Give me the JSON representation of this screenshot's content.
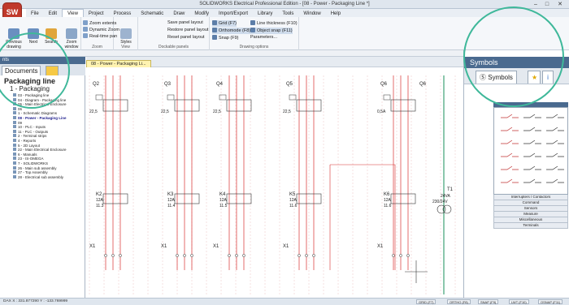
{
  "app": {
    "title": "SOLIDWORKS Electrical Professional Edition - [08 - Power - Packaging Line *]",
    "logo": "SW"
  },
  "menus": [
    "File",
    "Edit",
    "View",
    "Project",
    "Process",
    "Schematic",
    "Draw",
    "Modify",
    "Import/Export",
    "Library",
    "Tools",
    "Window",
    "Help"
  ],
  "active_menu": "View",
  "ribbon": {
    "view_group": {
      "label": "View",
      "previous": "Previous drawing",
      "next": "Next",
      "search": "Search",
      "zoom_window": "Zoom window",
      "zoom_extents": "Zoom extents",
      "dynamic_zoom": "Dynamic Zoom",
      "realtime_pan": "Real-time pan",
      "zoom_label": "Zoom"
    },
    "styles_group": {
      "label": "View",
      "styles": "Styles"
    },
    "panels_group": {
      "label": "Dockable panels",
      "save": "Save panel layout",
      "restore": "Restore panel layout",
      "reset": "Reset panel layout"
    },
    "drawing_options": {
      "label": "Drawing options",
      "grid": "Grid (F7)",
      "ortho": "Orthomode (F8)",
      "snap": "Snap (F9)",
      "line_thickness": "Line thickness (F10)",
      "object_snap": "Object snap (F11)",
      "parameters": "Parameters..."
    }
  },
  "left_panel": {
    "header": "nts",
    "tab": "Documents",
    "project": "Packaging line",
    "project_sub": "1 - Packaging",
    "tree": [
      {
        "label": "03 - Packaging line",
        "bold": false
      },
      {
        "label": "04 - Diagram - Packaging line",
        "bold": false
      },
      {
        "label": "05 - Main Electrical Enclosure",
        "bold": false
      },
      {
        "label": "06",
        "bold": false
      },
      {
        "label": "1 - Schematic Diagrams",
        "bold": false
      },
      {
        "label": "08 - Power - Packaging Line",
        "bold": true
      },
      {
        "label": "09",
        "bold": false
      },
      {
        "label": "10 - PLC - Inputs",
        "bold": false
      },
      {
        "label": "11 - PLC - Outputs",
        "bold": false
      },
      {
        "label": "2 - Terminal strips",
        "bold": false
      },
      {
        "label": "4 - Reports",
        "bold": false
      },
      {
        "label": "5 - 2D Layout",
        "bold": false
      },
      {
        "label": "22 - Main Electrical Enclosure",
        "bold": false
      },
      {
        "label": "6 - Manuals",
        "bold": false
      },
      {
        "label": "23 - IS-OMEGA",
        "bold": false
      },
      {
        "label": "7 - SOLIDWORKS",
        "bold": false
      },
      {
        "label": "26 - Main sub assembly",
        "bold": false
      },
      {
        "label": "27 - Top Assembly",
        "bold": false
      },
      {
        "label": "28 - Electrical sub assembly",
        "bold": false
      }
    ]
  },
  "canvas": {
    "tab": "08 - Power - Packaging Li...",
    "breakers": [
      "Q2",
      "Q3",
      "Q4",
      "Q5",
      "Q6"
    ],
    "breaker_ratings": [
      "22,5",
      "22,5",
      "22,5",
      "22,5",
      "0,5A"
    ],
    "contactors": [
      "K2",
      "K3",
      "K4",
      "K5",
      "K6"
    ],
    "contactor_ratings": [
      "12A",
      "12A",
      "12A",
      "12A",
      "12A"
    ],
    "contactor_refs": [
      "11.3",
      "11.4",
      "11.5",
      "11.6",
      "11.6"
    ],
    "transformer": {
      "name": "T1",
      "rating": "24VA",
      "voltage": "230/24V"
    },
    "terminals": [
      "X1",
      "X1",
      "X1",
      "X1",
      "X1"
    ]
  },
  "right_panel": {
    "header": "Symbols",
    "tab": "Symbols",
    "categories": [
      "Interrupters / Contactors",
      "Command",
      "Sensors",
      "Measure",
      "Miscellaneous",
      "Terminals"
    ]
  },
  "status": {
    "coords": "DAX X : 331.877290 Y : -133.769999",
    "buttons": [
      "GRID (F7)",
      "ORTHO (F8)",
      "SNAP (F9)",
      "LWT (F10)",
      "OSNAP (F11)"
    ]
  },
  "colors": {
    "accent": "#4a6a8f",
    "wire_red": "#d83030",
    "lens": "#3fb89a"
  }
}
